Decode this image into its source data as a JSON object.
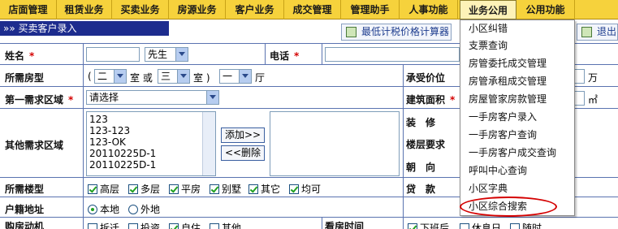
{
  "top_menu": [
    "店面管理",
    "租赁业务",
    "买卖业务",
    "房源业务",
    "客户业务",
    "成交管理",
    "管理助手",
    "人事功能",
    "业务公用",
    "公用功能"
  ],
  "title": "买卖客户录入",
  "toolbar": {
    "calc_label": "最低计税价格计算器",
    "exit_label": "退出"
  },
  "form": {
    "name_label": "姓名",
    "title_select": "先生",
    "phone_label": "电话",
    "room_type_label": "所需房型",
    "room_open": "(",
    "room_count": "二",
    "room_unit": "室 或",
    "room_count2": "三",
    "room_unit2": "室 )",
    "hall_count": "一",
    "hall_unit": "厅",
    "accept_price_label": "承受价位",
    "price_unit": "万",
    "area_first_label": "第一需求区域",
    "area_first_value": "请选择",
    "build_area_label": "建筑面积",
    "area_unit": "㎡",
    "other_area_label": "其他需求区域",
    "other_area_options": [
      "123",
      "123-123",
      "123-OK",
      "20110225D-1",
      "20110225D-1"
    ],
    "add_button": "添加>>",
    "remove_button": "<<删除",
    "decor_label": "装　修",
    "floor_req_label": "楼层要求",
    "orientation_label": "朝　向",
    "floor_type_label": "所需楼型",
    "floor_types": [
      "高层",
      "多层",
      "平房",
      "别墅",
      "其它",
      "均可"
    ],
    "loan_label": "贷　款",
    "hukou_label": "户籍地址",
    "hukou_options": [
      "本地",
      "外地"
    ],
    "hukou_selected": "本地",
    "motive_label": "购房动机",
    "motive_options": [
      "拆迁",
      "投资",
      "自住",
      "其他"
    ],
    "view_time_label": "看房时间",
    "view_time_options": [
      "下班后",
      "休息日",
      "随时"
    ]
  },
  "dropdown": {
    "items": [
      "小区纠错",
      "支票查询",
      "房管委托成交管理",
      "房管承租成交管理",
      "房屋管家房款管理",
      "一手房客户录入",
      "一手房客户查询",
      "一手房客户成交查询",
      "呼叫中心查询",
      "小区字典",
      "小区综合搜索"
    ],
    "highlighted": "小区综合搜索"
  },
  "colors": {
    "menu_bg": "#f6d23c",
    "title_bg": "#1d2c8e",
    "required": "#d40000",
    "highlight_circle": "#d40000"
  }
}
